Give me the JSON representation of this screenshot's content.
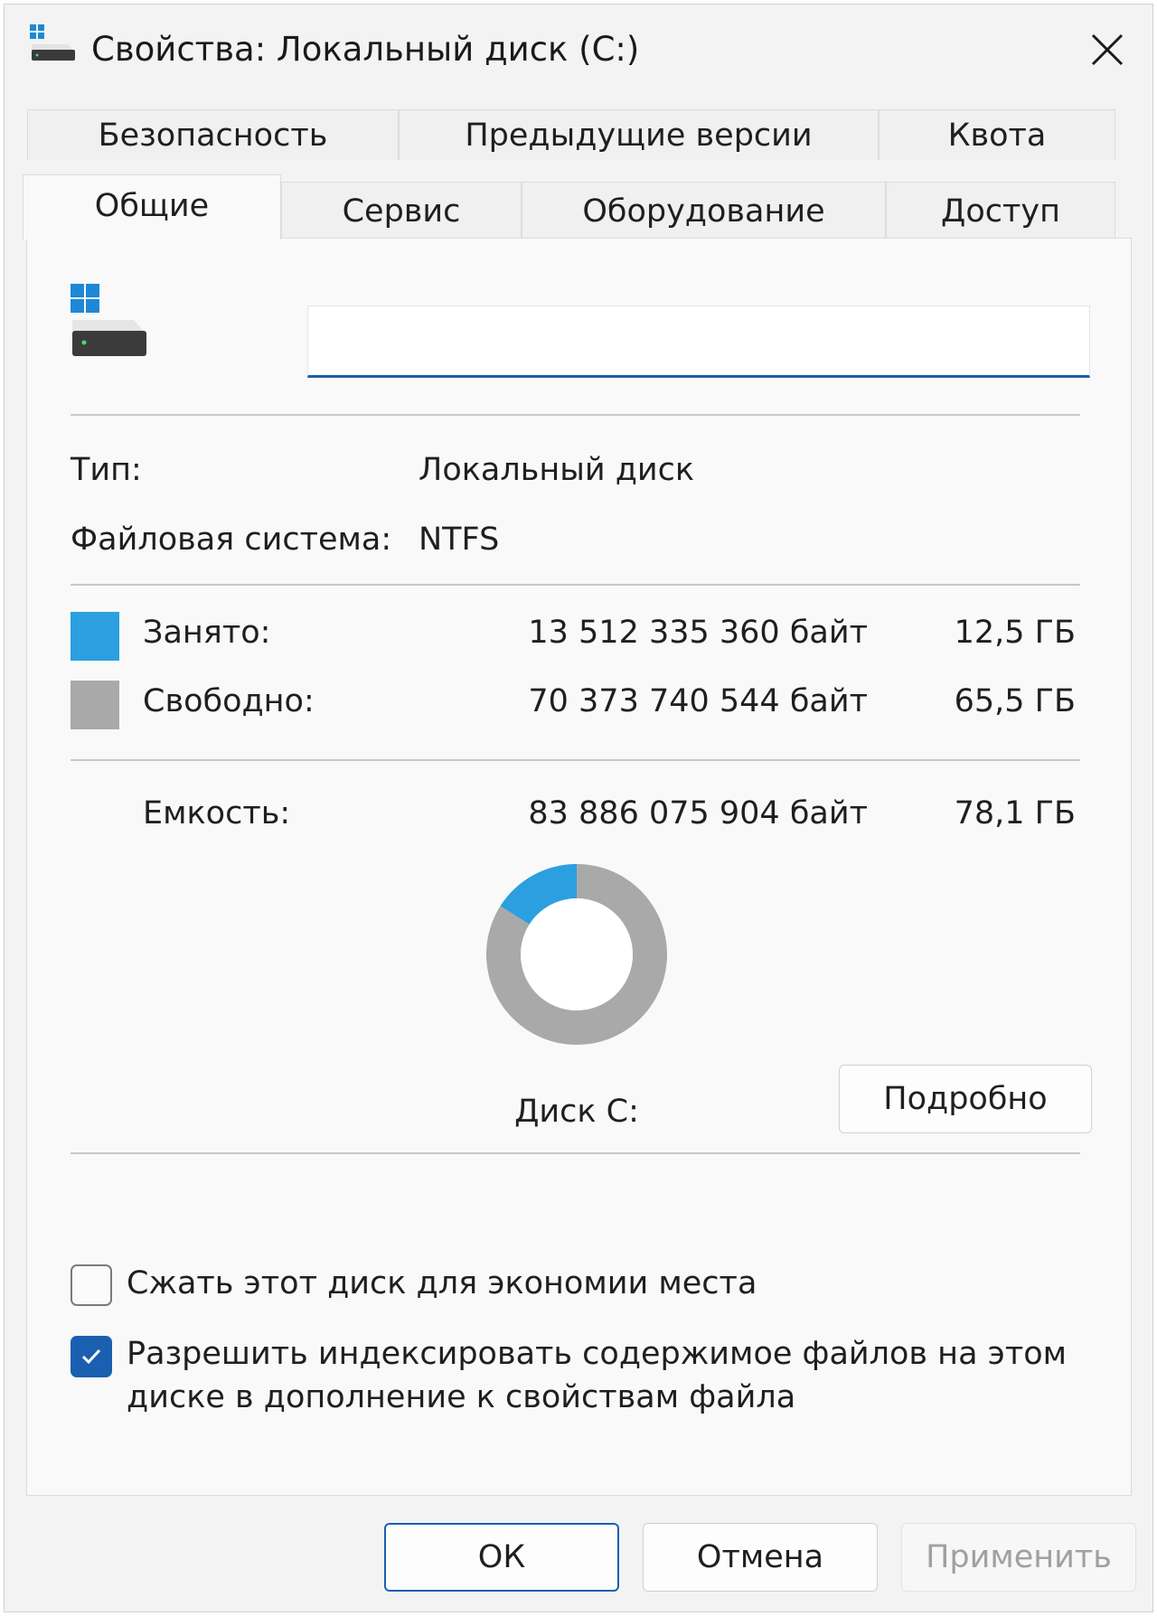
{
  "window": {
    "title": "Свойства: Локальный диск (C:)"
  },
  "tabs": {
    "row1": [
      "Безопасность",
      "Предыдущие версии",
      "Квота"
    ],
    "row2": [
      "Общие",
      "Сервис",
      "Оборудование",
      "Доступ"
    ],
    "active": "Общие"
  },
  "general": {
    "volume_name": "",
    "type_label": "Тип:",
    "type_value": "Локальный диск",
    "fs_label": "Файловая система:",
    "fs_value": "NTFS",
    "used": {
      "label": "Занято:",
      "bytes": "13 512 335 360 байт",
      "size": "12,5 ГБ",
      "color": "#2c9fe0"
    },
    "free": {
      "label": "Свободно:",
      "bytes": "70 373 740 544 байт",
      "size": "65,5 ГБ",
      "color": "#a9a9a9"
    },
    "capacity": {
      "label": "Емкость:",
      "bytes": "83 886 075 904 байт",
      "size": "78,1 ГБ"
    },
    "disk_label": "Диск C:",
    "details_button": "Подробно",
    "compress_label": "Сжать этот диск для экономии места",
    "compress_checked": false,
    "index_label_line1": "Разрешить индексировать содержимое файлов на этом",
    "index_label_line2": "диске в дополнение к свойствам файла",
    "index_checked": true
  },
  "chart_data": {
    "type": "pie",
    "categories": [
      "Занято:",
      "Свободно:"
    ],
    "values": [
      12.5,
      65.5
    ],
    "colors": [
      "#2c9fe0",
      "#a9a9a9"
    ],
    "title": "Диск C:"
  },
  "footer": {
    "ok": "ОК",
    "cancel": "Отмена",
    "apply": "Применить"
  },
  "icons": {
    "title": "drive-icon",
    "close": "close-icon",
    "drive": "drive-icon",
    "check": "checkmark-icon"
  }
}
